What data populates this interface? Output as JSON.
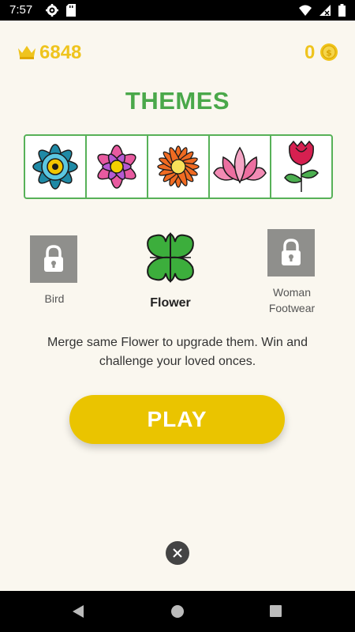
{
  "status_bar": {
    "time": "7:57",
    "icons": [
      "gear-icon",
      "sd-card-icon",
      "wifi-icon",
      "no-signal-icon",
      "battery-icon"
    ]
  },
  "stats": {
    "score": "6848",
    "coins": "0"
  },
  "title": "THEMES",
  "flowers": [
    "mandala-flower",
    "pink-flower",
    "orange-daisy",
    "lotus",
    "rose"
  ],
  "themes": [
    {
      "label": "Bird",
      "locked": true
    },
    {
      "label": "Flower",
      "locked": false
    },
    {
      "label": "Woman Footwear",
      "label_line1": "Woman",
      "label_line2": "Footwear",
      "locked": true
    }
  ],
  "description": {
    "line1": "Merge same Flower to upgrade them. Win and",
    "line2": "challenge your loved onces."
  },
  "play_label": "PLAY",
  "colors": {
    "background": "#faf7ef",
    "accent_yellow": "#eac400",
    "theme_green": "#4aa84a",
    "score_gold": "#efc41e"
  }
}
